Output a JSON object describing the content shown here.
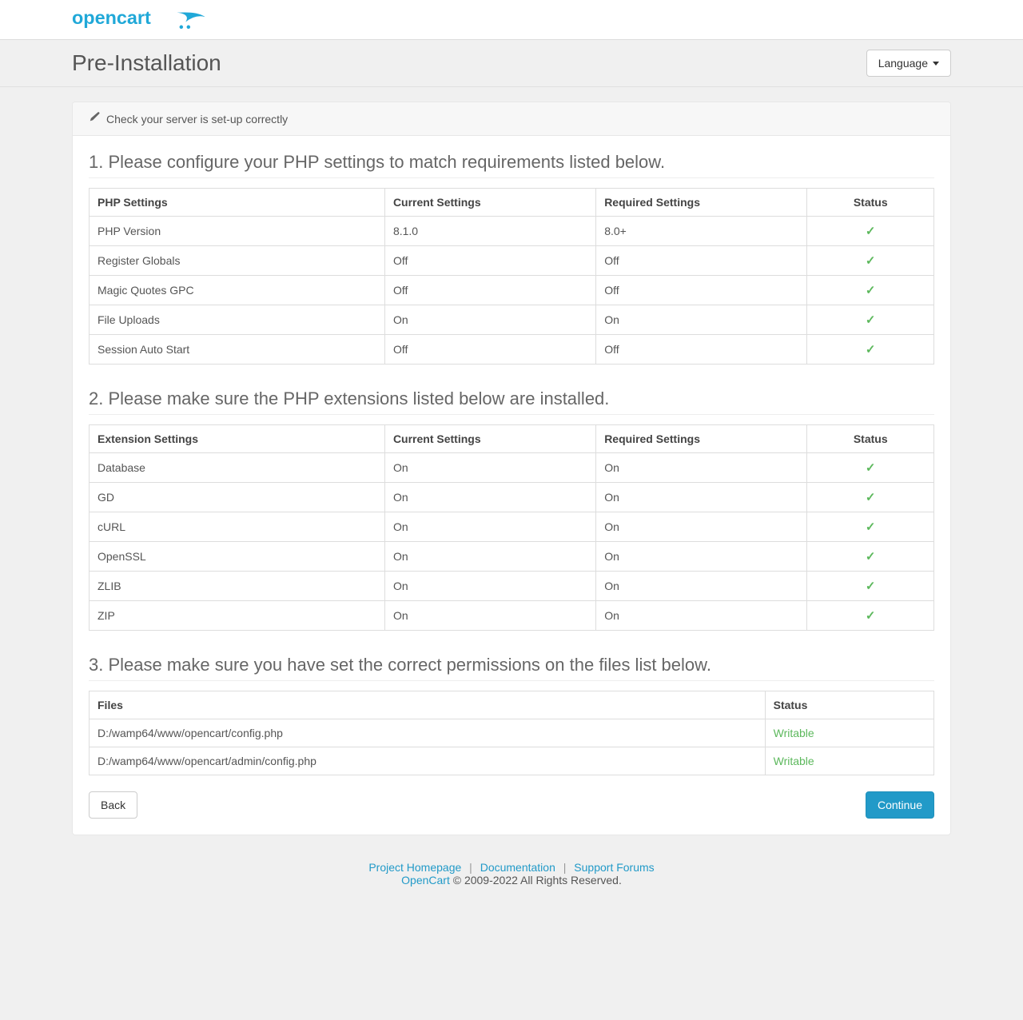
{
  "header": {
    "title": "Pre-Installation",
    "language_label": "Language"
  },
  "panel": {
    "heading": "Check your server is set-up correctly"
  },
  "section1": {
    "title": "1. Please configure your PHP settings to match requirements listed below.",
    "headers": {
      "c0": "PHP Settings",
      "c1": "Current Settings",
      "c2": "Required Settings",
      "c3": "Status"
    },
    "rows": [
      {
        "c0": "PHP Version",
        "c1": "8.1.0",
        "c2": "8.0+",
        "ok": true
      },
      {
        "c0": "Register Globals",
        "c1": "Off",
        "c2": "Off",
        "ok": true
      },
      {
        "c0": "Magic Quotes GPC",
        "c1": "Off",
        "c2": "Off",
        "ok": true
      },
      {
        "c0": "File Uploads",
        "c1": "On",
        "c2": "On",
        "ok": true
      },
      {
        "c0": "Session Auto Start",
        "c1": "Off",
        "c2": "Off",
        "ok": true
      }
    ]
  },
  "section2": {
    "title": "2. Please make sure the PHP extensions listed below are installed.",
    "headers": {
      "c0": "Extension Settings",
      "c1": "Current Settings",
      "c2": "Required Settings",
      "c3": "Status"
    },
    "rows": [
      {
        "c0": "Database",
        "c1": "On",
        "c2": "On",
        "ok": true
      },
      {
        "c0": "GD",
        "c1": "On",
        "c2": "On",
        "ok": true
      },
      {
        "c0": "cURL",
        "c1": "On",
        "c2": "On",
        "ok": true
      },
      {
        "c0": "OpenSSL",
        "c1": "On",
        "c2": "On",
        "ok": true
      },
      {
        "c0": "ZLIB",
        "c1": "On",
        "c2": "On",
        "ok": true
      },
      {
        "c0": "ZIP",
        "c1": "On",
        "c2": "On",
        "ok": true
      }
    ]
  },
  "section3": {
    "title": "3. Please make sure you have set the correct permissions on the files list below.",
    "headers": {
      "c0": "Files",
      "c1": "Status"
    },
    "rows": [
      {
        "c0": "D:/wamp64/www/opencart/config.php",
        "c1": "Writable"
      },
      {
        "c0": "D:/wamp64/www/opencart/admin/config.php",
        "c1": "Writable"
      }
    ]
  },
  "buttons": {
    "back": "Back",
    "continue": "Continue"
  },
  "footer": {
    "links": {
      "home": "Project Homepage",
      "docs": "Documentation",
      "forums": "Support Forums",
      "oc": "OpenCart"
    },
    "copyright": " © 2009-2022 All Rights Reserved."
  }
}
